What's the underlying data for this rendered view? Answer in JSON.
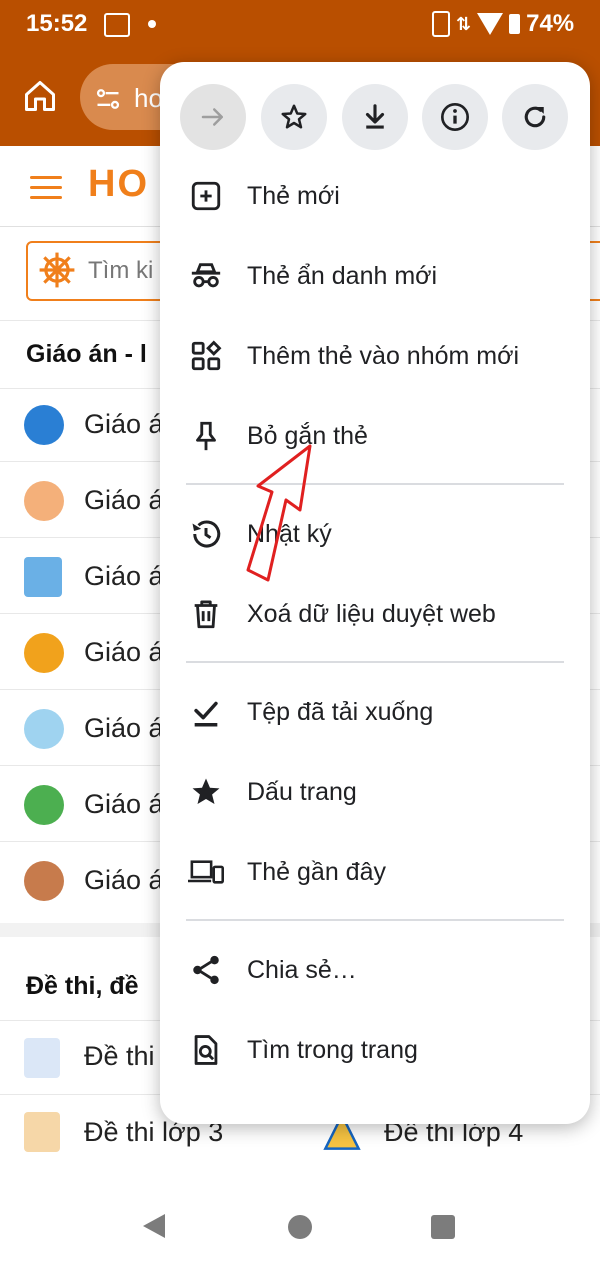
{
  "status_bar": {
    "time": "15:52",
    "battery": "74%"
  },
  "browser": {
    "url_partial": "ho"
  },
  "page": {
    "logo_partial": "HO",
    "search_placeholder": "Tìm ki",
    "section1_title": "Giáo án - l",
    "rows": [
      "Giáo á",
      "Giáo á",
      "Giáo á",
      "Giáo á",
      "Giáo á",
      "Giáo á",
      "Giáo á"
    ],
    "section2_title": "Đề thi, đề",
    "row_a": "Đề thi",
    "row_b_left": "Đề thi lớp 3",
    "row_b_right": "Đề thi lớp 4"
  },
  "menu": {
    "toolbar_icons": [
      "forward-icon",
      "star-icon",
      "download-icon",
      "info-icon",
      "refresh-icon"
    ],
    "items": [
      {
        "label": "Thẻ mới",
        "icon": "new-tab-icon"
      },
      {
        "label": "Thẻ ẩn danh mới",
        "icon": "incognito-icon"
      },
      {
        "label": "Thêm thẻ vào nhóm mới",
        "icon": "tab-group-icon"
      },
      {
        "label": "Bỏ gắn thẻ",
        "icon": "pin-icon"
      },
      {
        "label": "Nhật ký",
        "icon": "history-icon"
      },
      {
        "label": "Xoá dữ liệu duyệt web",
        "icon": "trash-icon"
      },
      {
        "label": "Tệp đã tải xuống",
        "icon": "downloads-icon"
      },
      {
        "label": "Dấu trang",
        "icon": "bookmarks-icon"
      },
      {
        "label": "Thẻ gần đây",
        "icon": "recent-tabs-icon"
      },
      {
        "label": "Chia sẻ…",
        "icon": "share-icon"
      },
      {
        "label": "Tìm trong trang",
        "icon": "find-in-page-icon"
      }
    ]
  },
  "colors": {
    "toolbar": "#b94f00",
    "brand": "#f07f1b",
    "annotation_arrow": "#e02020"
  }
}
